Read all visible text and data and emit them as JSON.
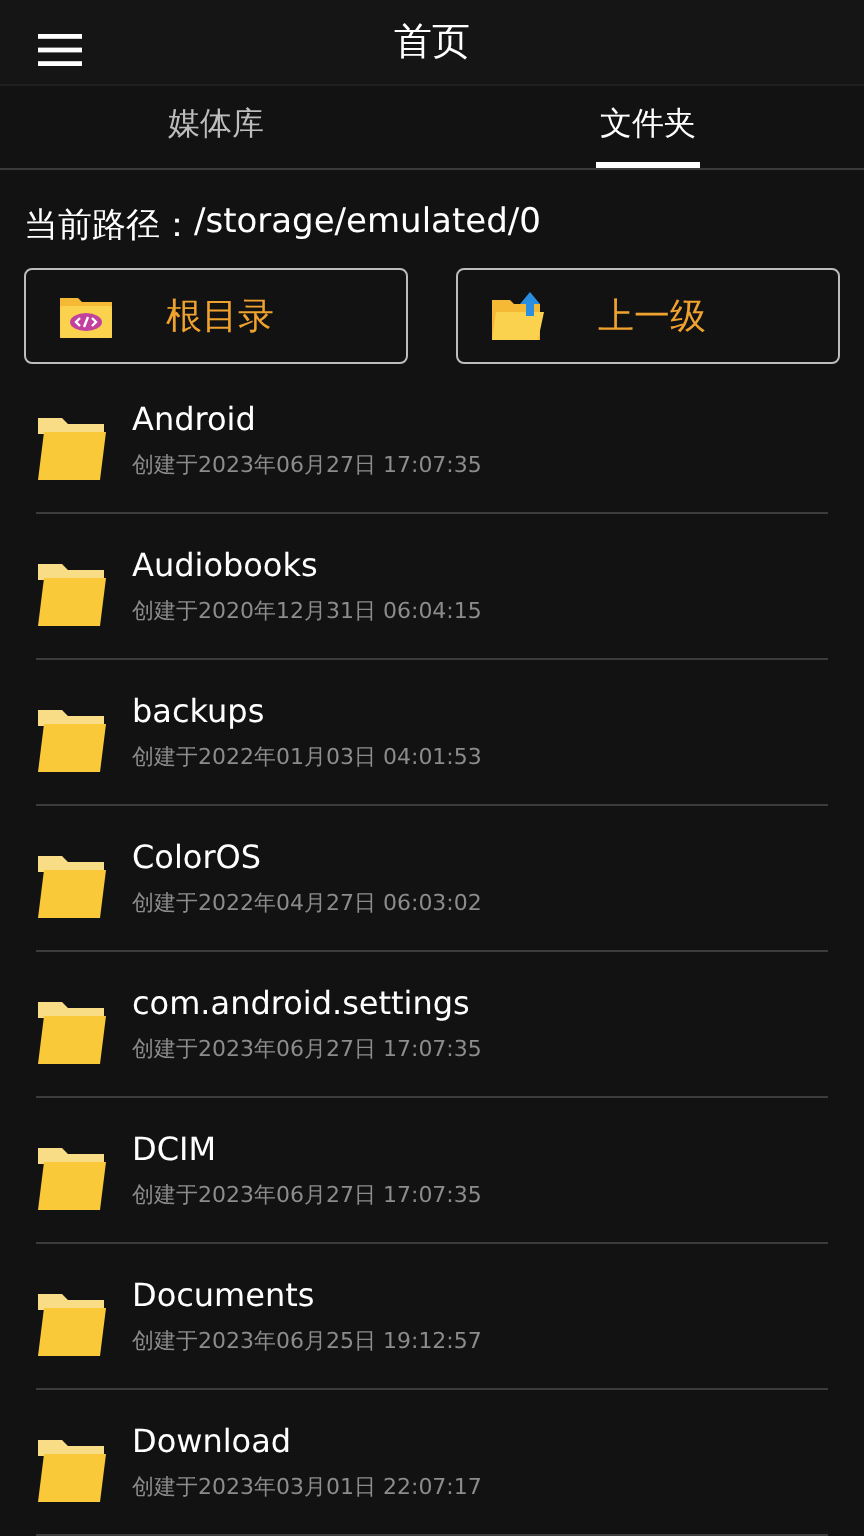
{
  "header": {
    "title": "首页"
  },
  "tabs": [
    {
      "label": "媒体库",
      "selected": false
    },
    {
      "label": "文件夹",
      "selected": true
    }
  ],
  "path": {
    "label": "当前路径：",
    "value": "/storage/emulated/0"
  },
  "buttons": [
    {
      "kind": "root",
      "label": "根目录"
    },
    {
      "kind": "up",
      "label": "上一级"
    }
  ],
  "folders": [
    {
      "name": "Android",
      "created": "创建于2023年06月27日 17:07:35"
    },
    {
      "name": "Audiobooks",
      "created": "创建于2020年12月31日 06:04:15"
    },
    {
      "name": "backups",
      "created": "创建于2022年01月03日 04:01:53"
    },
    {
      "name": "ColorOS",
      "created": "创建于2022年04月27日 06:03:02"
    },
    {
      "name": "com.android.settings",
      "created": "创建于2023年06月27日 17:07:35"
    },
    {
      "name": "DCIM",
      "created": "创建于2023年06月27日 17:07:35"
    },
    {
      "name": "Documents",
      "created": "创建于2023年06月25日 19:12:57"
    },
    {
      "name": "Download",
      "created": "创建于2023年03月01日 22:07:17"
    }
  ]
}
